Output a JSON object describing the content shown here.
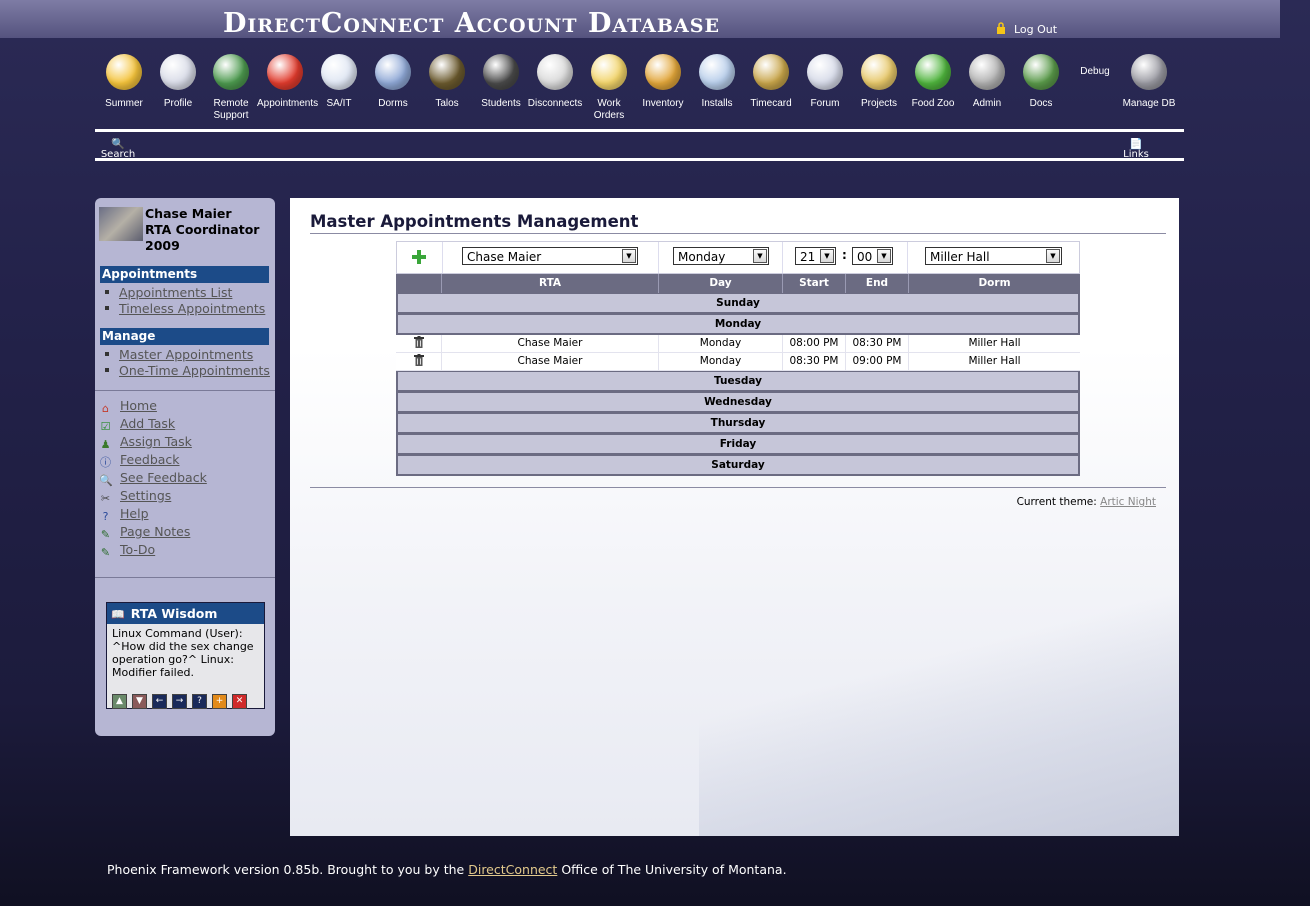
{
  "header": {
    "title": "DirectConnect Account Database",
    "logout_label": "Log Out"
  },
  "nav": {
    "items": [
      {
        "label": "Summer",
        "icon": "sunglasses-smiley-icon",
        "color": "#f4c33b"
      },
      {
        "label": "Profile",
        "icon": "profile-card-icon",
        "color": "#d8dbe7"
      },
      {
        "label": "Remote Support",
        "icon": "globe-icon",
        "color": "#4d9a4f"
      },
      {
        "label": "Appointments",
        "icon": "alarm-clock-icon",
        "color": "#e13b2d"
      },
      {
        "label": "SA/IT",
        "icon": "red-cross-icon",
        "color": "#dfe6f3"
      },
      {
        "label": "Dorms",
        "icon": "building-icon",
        "color": "#8fa8d6"
      },
      {
        "label": "Talos",
        "icon": "helmet-icon",
        "color": "#6b5a2e"
      },
      {
        "label": "Students",
        "icon": "student-icon",
        "color": "#4a4a4a"
      },
      {
        "label": "Disconnects",
        "icon": "disconnect-cable-icon",
        "color": "#d9d9d9"
      },
      {
        "label": "Work Orders",
        "icon": "pushpin-note-icon",
        "color": "#f2d46a"
      },
      {
        "label": "Inventory",
        "icon": "box-icon",
        "color": "#e2a63a"
      },
      {
        "label": "Installs",
        "icon": "install-window-icon",
        "color": "#b7cdea"
      },
      {
        "label": "Timecard",
        "icon": "money-bag-icon",
        "color": "#c8a54a"
      },
      {
        "label": "Forum",
        "icon": "speech-bubble-icon",
        "color": "#d6dae8"
      },
      {
        "label": "Projects",
        "icon": "folder-icon",
        "color": "#e7c86a"
      },
      {
        "label": "Food Zoo",
        "icon": "apple-icon",
        "color": "#4fb43d"
      },
      {
        "label": "Admin",
        "icon": "gears-icon",
        "color": "#b0b0b0"
      },
      {
        "label": "Docs",
        "icon": "books-icon",
        "color": "#5a9a4a"
      },
      {
        "label": "Debug",
        "icon": "",
        "color": ""
      },
      {
        "label": "Manage DB",
        "icon": "database-check-icon",
        "color": "#9a9aa2"
      }
    ],
    "search_label": "Search",
    "links_label": "Links"
  },
  "sidebar": {
    "user_name": "Chase Maier",
    "user_role": "RTA Coordinator",
    "user_year": "2009",
    "sections": [
      {
        "title": "Appointments",
        "items": [
          "Appointments List",
          "Timeless Appointments"
        ]
      },
      {
        "title": "Manage",
        "items": [
          "Master Appointments",
          "One-Time Appointments"
        ]
      }
    ],
    "links": [
      {
        "label": "Home",
        "icon": "home-icon"
      },
      {
        "label": "Add Task",
        "icon": "checklist-icon"
      },
      {
        "label": "Assign Task",
        "icon": "assign-person-icon"
      },
      {
        "label": "Feedback",
        "icon": "info-icon"
      },
      {
        "label": "See Feedback",
        "icon": "magnifier-icon"
      },
      {
        "label": "Settings",
        "icon": "scissors-tools-icon"
      },
      {
        "label": "Help",
        "icon": "help-icon"
      },
      {
        "label": "Page Notes",
        "icon": "note-pencil-icon"
      },
      {
        "label": "To-Do",
        "icon": "todo-pencil-icon"
      }
    ],
    "wisdom": {
      "title": "RTA Wisdom",
      "text": "Linux Command (User): ^How did the sex change operation go?^ Linux: Modifier failed."
    }
  },
  "main": {
    "title": "Master Appointments Management",
    "form": {
      "rta": "Chase Maier",
      "day": "Monday",
      "start_hour": "21",
      "start_min": "00",
      "dorm": "Miller Hall",
      "colon": ":"
    },
    "columns": [
      "RTA",
      "Day",
      "Start",
      "End",
      "Dorm"
    ],
    "days": {
      "sunday": "Sunday",
      "monday": "Monday",
      "tuesday": "Tuesday",
      "wednesday": "Wednesday",
      "thursday": "Thursday",
      "friday": "Friday",
      "saturday": "Saturday"
    },
    "appointments": [
      {
        "rta": "Chase Maier",
        "day": "Monday",
        "start": "08:00 PM",
        "end": "08:30 PM",
        "dorm": "Miller Hall"
      },
      {
        "rta": "Chase Maier",
        "day": "Monday",
        "start": "08:30 PM",
        "end": "09:00 PM",
        "dorm": "Miller Hall"
      }
    ],
    "theme_label": "Current theme:",
    "theme_name": "Artic Night"
  },
  "footer": {
    "pre": "Phoenix Framework version 0.85b. Brought to you by the",
    "link": "DirectConnect",
    "post": "Office of The University of Montana."
  }
}
